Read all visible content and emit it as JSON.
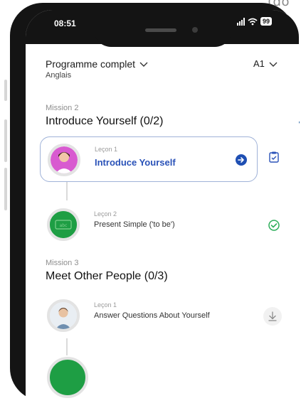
{
  "caption": "(do",
  "status": {
    "time": "08:51",
    "battery": "99"
  },
  "header": {
    "title": "Programme complet",
    "subtitle": "Anglais",
    "level": "A1"
  },
  "missions": [
    {
      "label": "Mission 2",
      "title": "Introduce Yourself (0/2)",
      "lessons": [
        {
          "label": "Leçon 1",
          "name": "Introduce Yourself",
          "state": "selected"
        },
        {
          "label": "Leçon 2",
          "name": "Present Simple ('to be')",
          "state": "completed"
        }
      ]
    },
    {
      "label": "Mission 3",
      "title": "Meet Other People (0/3)",
      "lessons": [
        {
          "label": "Leçon 1",
          "name": "Answer Questions About Yourself",
          "state": "download"
        }
      ]
    }
  ],
  "icons": {
    "header_dropdown": "chevron-down-icon",
    "level_dropdown": "chevron-down-icon",
    "go": "arrow-right-circle-icon",
    "clipboard": "clipboard-check-icon",
    "completed": "check-circle-icon",
    "download": "download-icon"
  },
  "colors": {
    "accent": "#1f4fb3",
    "selected_border": "#9fb2d8",
    "completed_green": "#2fae5c",
    "avatar_green": "#1e9e44",
    "avatar_pink": "#d85ad0"
  }
}
